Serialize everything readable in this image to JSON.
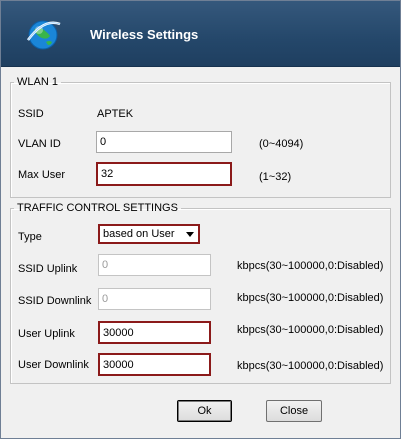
{
  "window": {
    "title": "Wireless Settings",
    "icon": "globe-icon"
  },
  "wlan": {
    "legend": "WLAN 1",
    "ssid_label": "SSID",
    "ssid_value": "APTEK",
    "vlan_label": "VLAN ID",
    "vlan_value": "0",
    "vlan_hint": "(0~4094)",
    "maxuser_label": "Max User",
    "maxuser_value": "32",
    "maxuser_hint": "(1~32)"
  },
  "traffic": {
    "legend": "TRAFFIC CONTROL SETTINGS",
    "type_label": "Type",
    "type_value": "based on User",
    "ssid_uplink_label": "SSID Uplink",
    "ssid_uplink_value": "0",
    "ssid_downlink_label": "SSID Downlink",
    "ssid_downlink_value": "0",
    "user_uplink_label": "User Uplink",
    "user_uplink_value": "30000",
    "user_downlink_label": "User Downlink",
    "user_downlink_value": "30000",
    "rate_hint": "kbpcs(30~100000,0:Disabled)"
  },
  "buttons": {
    "ok": "Ok",
    "close": "Close"
  },
  "colors": {
    "titlebar": "#24476a",
    "highlight_border": "#8b1a1a",
    "dialog_bg": "#f0f0f0"
  }
}
